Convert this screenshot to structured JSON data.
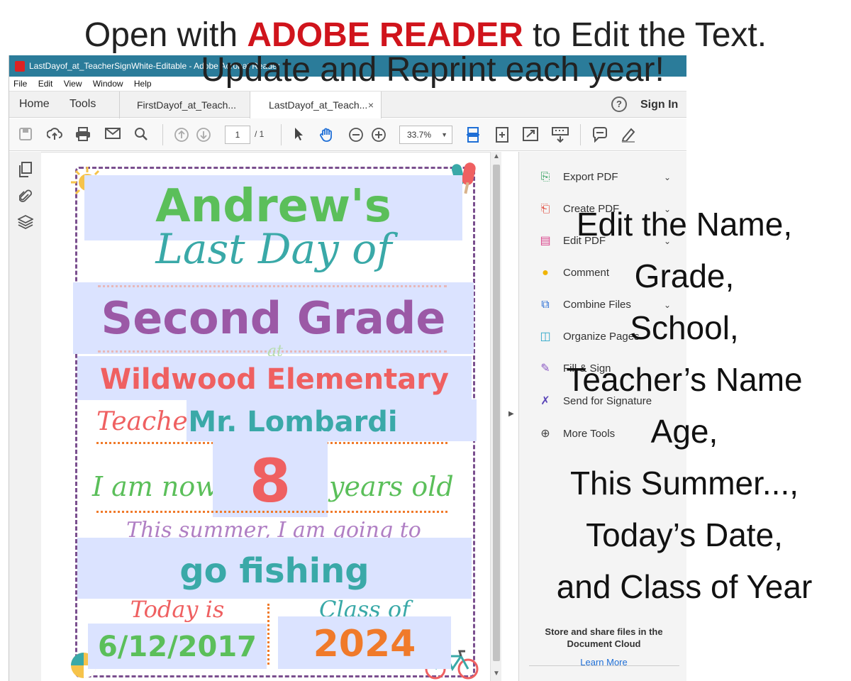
{
  "headline": {
    "prefix": "Open with ",
    "brand": "ADOBE READER",
    "suffix": " to Edit the Text.",
    "sub": "Update and Reprint each year!"
  },
  "window": {
    "title": "LastDayof_at_TeacherSignWhite-Editable - Adobe Acrobat Reader"
  },
  "menu": [
    "File",
    "Edit",
    "View",
    "Window",
    "Help"
  ],
  "nav": {
    "home": "Home",
    "tools": "Tools",
    "tab1": "FirstDayof_at_Teach...",
    "tab2": "LastDayof_at_Teach...",
    "tab_close": "×",
    "help": "?",
    "signin": "Sign In"
  },
  "toolbar": {
    "page_current": "1",
    "page_total": "/ 1",
    "zoom": "33.7%"
  },
  "right_panel": {
    "items": [
      {
        "label": "Export PDF",
        "icon": "export-pdf-icon",
        "color": "#2e9e5a"
      },
      {
        "label": "Create PDF",
        "icon": "create-pdf-icon",
        "color": "#e0483a"
      },
      {
        "label": "Edit PDF",
        "icon": "edit-pdf-icon",
        "color": "#d9458c"
      },
      {
        "label": "Comment",
        "icon": "comment-icon",
        "color": "#f0b400"
      },
      {
        "label": "Combine Files",
        "icon": "combine-files-icon",
        "color": "#2b6fd6"
      },
      {
        "label": "Organize Pages",
        "icon": "organize-pages-icon",
        "color": "#2fa7c9"
      },
      {
        "label": "Fill & Sign",
        "icon": "fill-sign-icon",
        "color": "#8a58c4"
      },
      {
        "label": "Send for Signature",
        "icon": "send-signature-icon",
        "color": "#5a45b8"
      },
      {
        "label": "More Tools",
        "icon": "more-tools-icon",
        "color": "#444444"
      }
    ],
    "cloud_text": "Store and share files in the Document Cloud",
    "learn_more": "Learn More"
  },
  "sign": {
    "name": "Andrew's",
    "last_day_of": "Last Day of",
    "grade": "Second Grade",
    "at": "at",
    "school": "Wildwood Elementary",
    "teacher_label": "Teacher:",
    "teacher": "Mr. Lombardi",
    "age_prefix": "I am now",
    "age": "8",
    "age_suffix": "years old",
    "summer_label": "This summer, I am going to",
    "summer": "go fishing",
    "today_label": "Today is",
    "date": "6/12/2017",
    "class_label": "Class of",
    "year": "2024"
  },
  "edit_caption": [
    "Edit the Name,",
    "Grade,",
    "School,",
    "Teacher’s Name",
    "Age,",
    "This Summer...,",
    "Today’s Date,",
    "and Class of Year"
  ],
  "colors": {
    "titlebar": "#2b7c9a",
    "field": "#dbe3ff",
    "frame": "#7a4f8e",
    "green": "#5bbf5a",
    "teal": "#3aa9a8",
    "purple": "#9b59a6",
    "coral": "#ef6061",
    "orange": "#f07a2a",
    "brand_red": "#d0141c"
  }
}
